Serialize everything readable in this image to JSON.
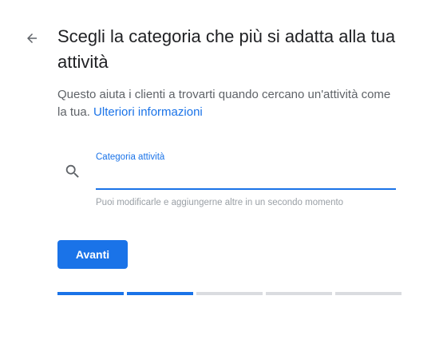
{
  "header": {
    "back_icon": "arrow-left-icon",
    "title": "Scegli la categoria che più si adatta alla tua attività"
  },
  "intro": {
    "text": "Questo aiuta i clienti a trovarti quando cercano un'attività come la tua. ",
    "link": "Ulteriori informazioni"
  },
  "form": {
    "icon": "search-icon",
    "label": "Categoria attività",
    "value": "",
    "helper": "Puoi modificarle e aggiungerne altre in un secondo momento"
  },
  "actions": {
    "next_label": "Avanti"
  },
  "progress": {
    "total_steps": 5,
    "completed_steps": 2
  },
  "colors": {
    "accent": "#1a73e8",
    "track": "#dadce0",
    "text": "#202124",
    "muted": "#5f6368"
  }
}
